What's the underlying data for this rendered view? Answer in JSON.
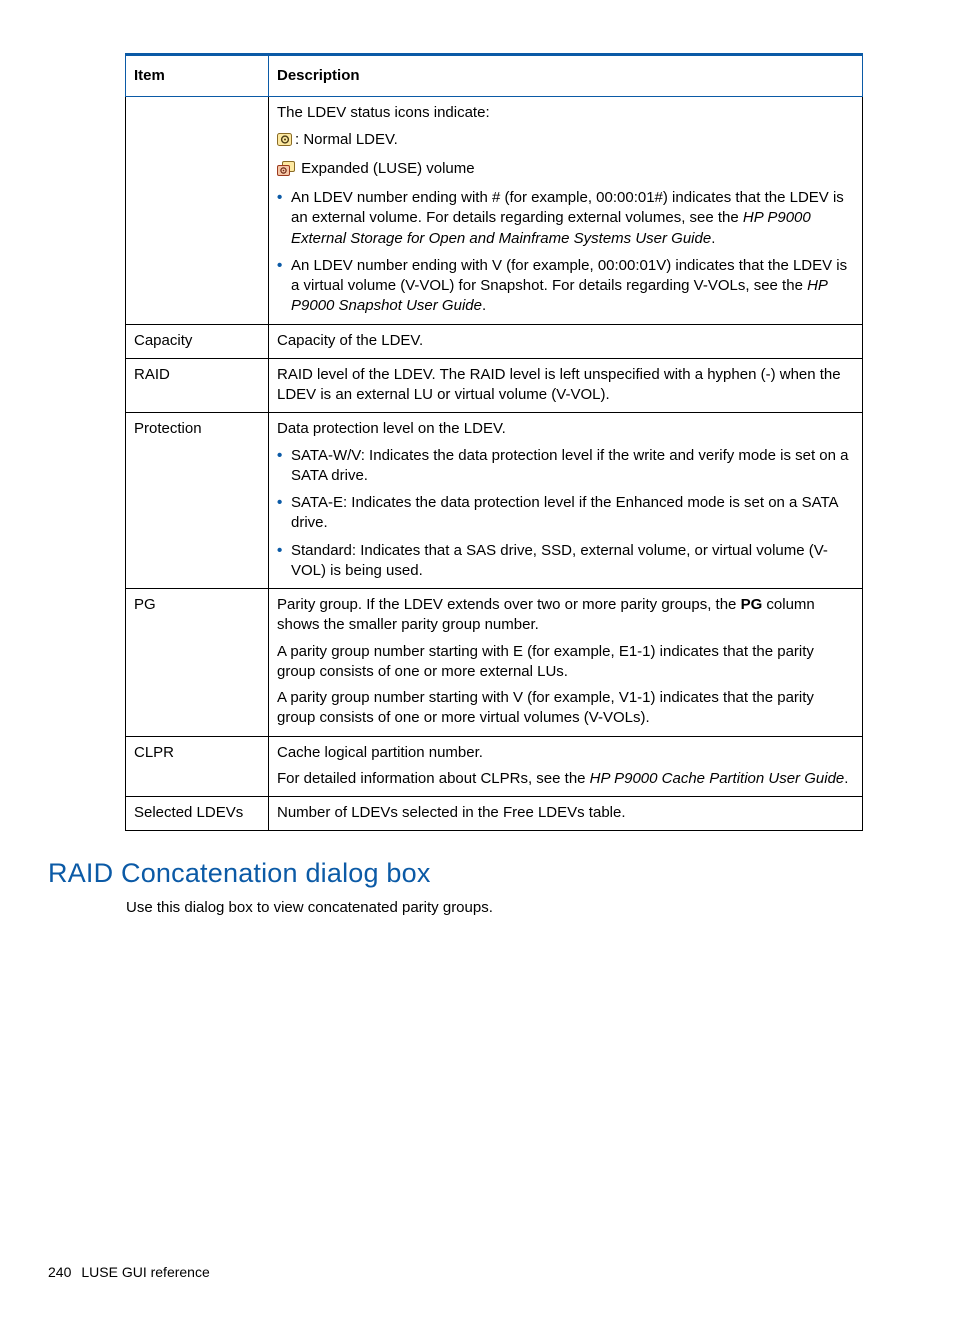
{
  "table": {
    "header": {
      "item": "Item",
      "desc": "Description"
    },
    "rows": {
      "ldev_status": {
        "item": "",
        "intro": "The LDEV status icons indicate:",
        "normal": ": Normal LDEV.",
        "expanded": " Expanded (LUSE) volume",
        "b1a": "An LDEV number ending with # (for example, 00:00:01#) indicates that the LDEV is an external volume. For details regarding external volumes, see the ",
        "b1i": "HP P9000 External Storage for Open and Mainframe Systems User Guide",
        "b1z": ".",
        "b2a": "An LDEV number ending with V (for example, 00:00:01V) indicates that the LDEV is a virtual volume (V-VOL) for Snapshot. For details regarding V-VOLs, see the ",
        "b2i": "HP P9000 Snapshot User Guide",
        "b2z": "."
      },
      "capacity": {
        "item": "Capacity",
        "desc": "Capacity of the LDEV."
      },
      "raid": {
        "item": "RAID",
        "desc": "RAID level of the LDEV. The RAID level is left unspecified with a hyphen (-) when the LDEV is an external LU or virtual volume (V-VOL)."
      },
      "protection": {
        "item": "Protection",
        "p1": "Data protection level on the LDEV.",
        "b1": "SATA-W/V: Indicates the data protection level if the write and verify mode is set on a SATA drive.",
        "b2": "SATA-E: Indicates the data protection level if the Enhanced mode is set on a SATA drive.",
        "b3": "Standard: Indicates that a SAS drive, SSD, external volume, or virtual volume (V-VOL) is being used."
      },
      "pg": {
        "item": "PG",
        "p1a": "Parity group. If the LDEV extends over two or more parity groups, the ",
        "p1b": "PG",
        "p1c": " column shows the smaller parity group number.",
        "p2": "A parity group number starting with E (for example, E1-1) indicates that the parity group consists of one or more external LUs.",
        "p3": "A parity group number starting with V (for example, V1-1) indicates that the parity group consists of one or more virtual volumes (V-VOLs)."
      },
      "clpr": {
        "item": "CLPR",
        "p1": "Cache logical partition number.",
        "p2a": "For detailed information about CLPRs, see the ",
        "p2i": "HP P9000 Cache Partition User Guide",
        "p2z": "."
      },
      "selected": {
        "item": "Selected LDEVs",
        "desc": "Number of LDEVs selected in the Free LDEVs table."
      }
    }
  },
  "section": {
    "heading": "RAID Concatenation dialog box",
    "body": "Use this dialog box to view concatenated parity groups."
  },
  "footer": {
    "page": "240",
    "title": "LUSE GUI reference"
  }
}
